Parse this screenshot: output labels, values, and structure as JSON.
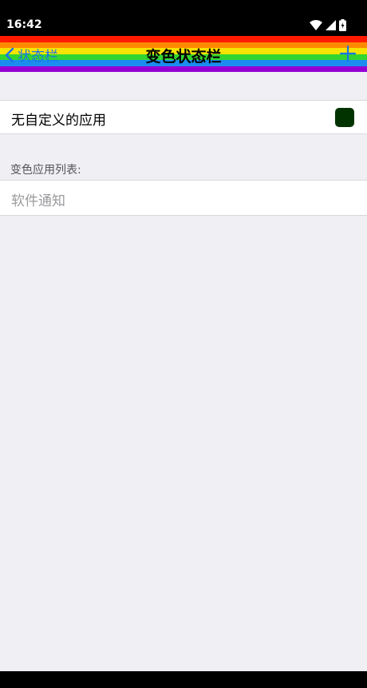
{
  "status_bar": {
    "time": "16:42",
    "icons": [
      "wifi-icon",
      "signal-icon",
      "battery-icon"
    ]
  },
  "nav": {
    "back_label": "状态栏",
    "title": "变色状态栏",
    "add_icon": "plus-icon",
    "accent_color": "#1a73e8",
    "rainbow_colors": [
      "#ff1a00",
      "#ff8a00",
      "#f7e300",
      "#33d52f",
      "#1c8cf0",
      "#9400d3"
    ]
  },
  "default_row": {
    "label": "无自定义的应用",
    "swatch_color": "#003300"
  },
  "list_section": {
    "header": "变色应用列表:",
    "placeholder": "软件通知"
  }
}
